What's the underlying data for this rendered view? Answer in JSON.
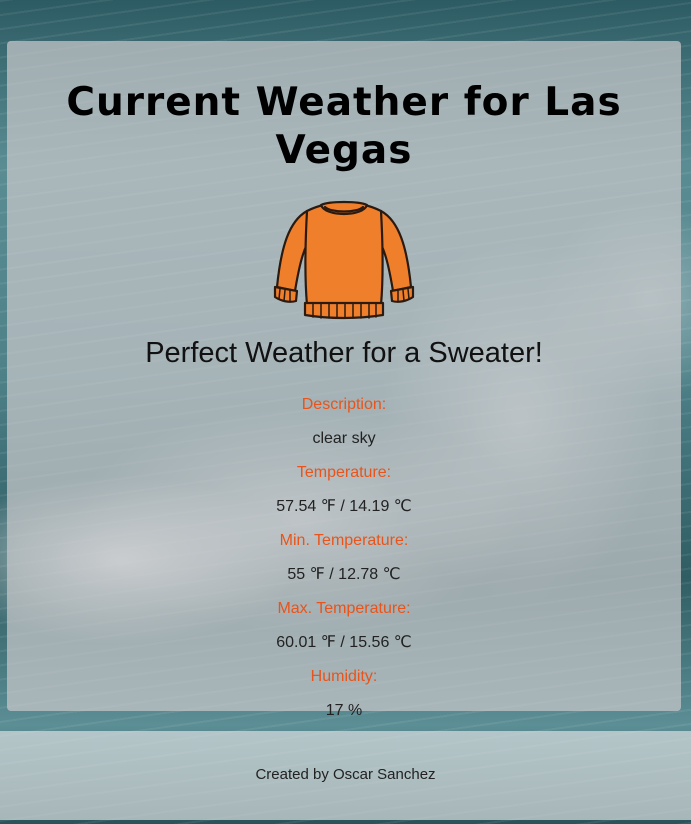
{
  "header": {
    "title": "Current Weather for Las Vegas"
  },
  "recommendation": {
    "icon": "sweater-icon",
    "text": "Perfect Weather for a Sweater!"
  },
  "weather": {
    "description_label": "Description:",
    "description_value": "clear sky",
    "temperature_label": "Temperature:",
    "temperature_value": "57.54 ℉ / 14.19 ℃",
    "min_temperature_label": "Min. Temperature:",
    "min_temperature_value": "55 ℉ / 12.78 ℃",
    "max_temperature_label": "Max. Temperature:",
    "max_temperature_value": "60.01 ℉ / 15.56 ℃",
    "humidity_label": "Humidity:",
    "humidity_value": "17 %"
  },
  "footer": {
    "credit": "Created by Oscar Sanchez"
  },
  "colors": {
    "label_accent": "#e8541a",
    "sweater_fill": "#f07f2c"
  }
}
